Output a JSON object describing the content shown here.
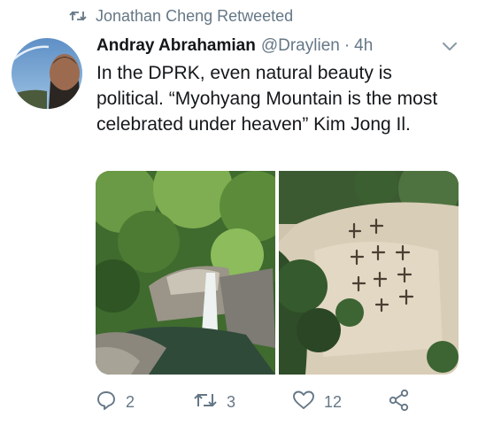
{
  "retweet_context": {
    "icon": "retweet-icon",
    "text": "Jonathan Cheng Retweeted"
  },
  "tweet": {
    "author_name": "Andray Abrahamian",
    "author_handle": "@Draylien",
    "separator": "·",
    "time": "4h",
    "text": "In the DPRK, even natural beauty is political. “Myohyang Mountain is the most celebrated under heaven” Kim Jong Il.",
    "media": [
      {
        "kind": "photo",
        "subject": "waterfall in forest"
      },
      {
        "kind": "photo",
        "subject": "cliff with carved inscription"
      }
    ],
    "media_inscriptions": [
      "김정일",
      "천하제일명산"
    ]
  },
  "actions": {
    "reply": {
      "icon": "reply-icon",
      "count": "2"
    },
    "retweet": {
      "icon": "retweet-icon",
      "count": "3"
    },
    "like": {
      "icon": "heart-icon",
      "count": "12"
    },
    "share": {
      "icon": "share-icon"
    }
  },
  "colors": {
    "text": "#14171a",
    "muted": "#657786",
    "background": "#ffffff"
  }
}
